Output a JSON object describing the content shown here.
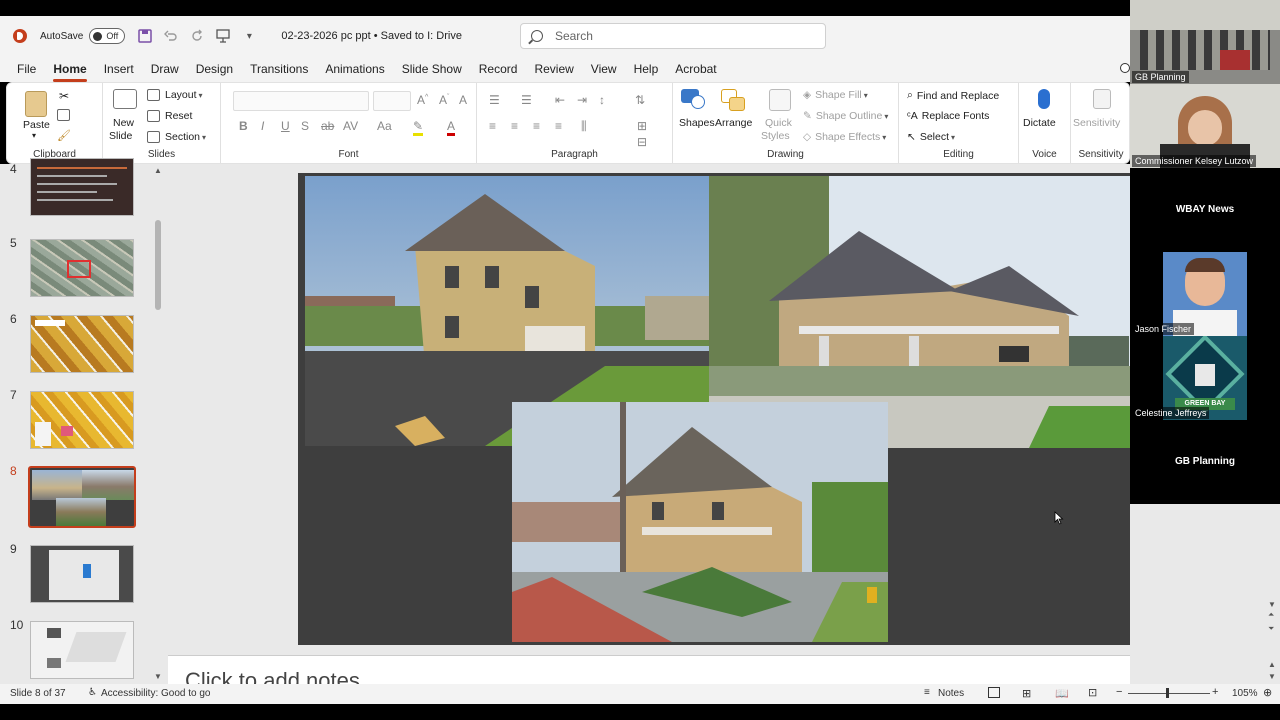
{
  "titlebar": {
    "autosave_label": "AutoSave",
    "autosave_state": "Off",
    "doc_title": "02-23-2026 pc ppt • Saved to I: Drive",
    "search_placeholder": "Search"
  },
  "menu": [
    "File",
    "Home",
    "Insert",
    "Draw",
    "Design",
    "Transitions",
    "Animations",
    "Slide Show",
    "Record",
    "Review",
    "View",
    "Help",
    "Acrobat"
  ],
  "menu_active": "Home",
  "ribbon": {
    "clipboard": {
      "label": "Clipboard",
      "paste": "Paste"
    },
    "slides": {
      "label": "Slides",
      "new_slide_1": "New",
      "new_slide_2": "Slide",
      "layout": "Layout",
      "reset": "Reset",
      "section": "Section"
    },
    "font": {
      "label": "Font"
    },
    "paragraph": {
      "label": "Paragraph"
    },
    "drawing": {
      "label": "Drawing",
      "shapes": "Shapes",
      "arrange": "Arrange",
      "quick_styles_1": "Quick",
      "quick_styles_2": "Styles",
      "shape_fill": "Shape Fill",
      "shape_outline": "Shape Outline",
      "shape_effects": "Shape Effects"
    },
    "editing": {
      "label": "Editing",
      "find_replace": "Find and Replace",
      "replace_fonts": "Replace Fonts",
      "select": "Select"
    },
    "voice": {
      "label": "Voice",
      "dictate": "Dictate"
    },
    "sensitivity": {
      "label": "Sensitivity",
      "button": "Sensitivity"
    }
  },
  "thumbnails": [
    {
      "num": "4"
    },
    {
      "num": "5"
    },
    {
      "num": "6"
    },
    {
      "num": "7"
    },
    {
      "num": "8"
    },
    {
      "num": "9"
    },
    {
      "num": "10"
    }
  ],
  "notes_placeholder": "Click to add notes",
  "status": {
    "slide_info": "Slide 8 of 37",
    "accessibility": "Accessibility: Good to go",
    "notes": "Notes",
    "zoom": "105%"
  },
  "video": {
    "tile_1_label": "GB Planning",
    "tile_2_label": "Commissioner Kelsey Lutzow",
    "tile_3_label": "WBAY News",
    "tile_4_label": "Jason Fischer",
    "tile_5_label": "Celestine Jeffreys",
    "tile_6_label": "GB Planning",
    "logo_text": "GREEN BAY"
  },
  "colors": {
    "accent": "#c43e1c",
    "slide_bg": "#3e3e3e",
    "pane_bg": "#e9e9e9"
  }
}
